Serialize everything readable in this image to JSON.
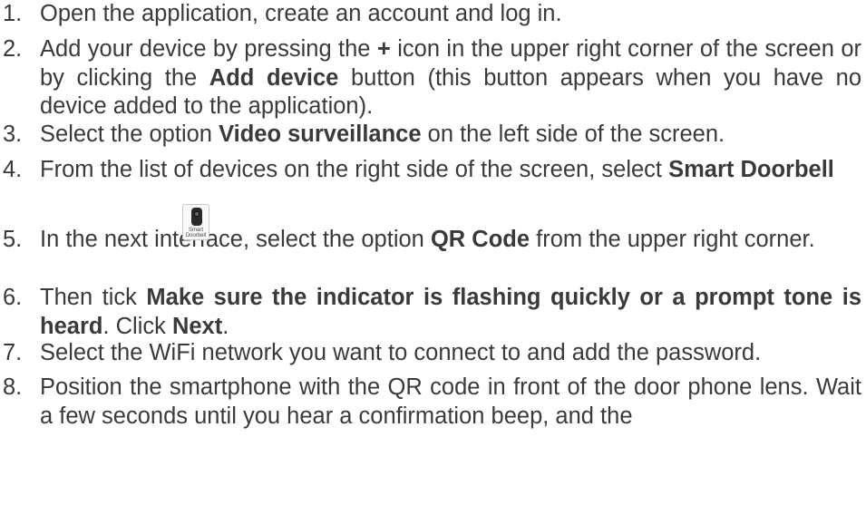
{
  "steps": [
    {
      "number": "1.",
      "parts": [
        "Open the application, create an account and log in."
      ]
    },
    {
      "number": "2.",
      "parts": [
        "Add your device by pressing the ",
        "+",
        " icon in the upper right corner of the screen or by clicking the ",
        "Add device",
        " button (this button appears when you have no device added to the application)."
      ]
    },
    {
      "number": "3.",
      "parts": [
        "Select the option ",
        "Video surveillance",
        " on the left side of the screen."
      ]
    },
    {
      "number": "4.",
      "parts": [
        "From the list of devices on the right side of the screen, select ",
        "Smart Doorbell"
      ],
      "icon": {
        "name": "smart-doorbell-icon",
        "caption_line1": "Smart",
        "caption_line2": "Doorbell"
      }
    },
    {
      "number": "5.",
      "parts": [
        "In the next interface, select the option ",
        "QR Code",
        " from the upper right corner."
      ]
    },
    {
      "number": "6.",
      "parts": [
        "Then tick ",
        "Make sure the indicator is flashing quickly or a prompt tone is heard",
        ". Click ",
        "Next",
        "."
      ]
    },
    {
      "number": "7.",
      "parts": [
        "Select the WiFi network you want to connect to and add the password."
      ]
    },
    {
      "number": "8.",
      "parts": [
        "Position the smartphone with the QR code in front of the door phone lens. Wait a few seconds until you hear a confirmation beep, and the"
      ]
    }
  ]
}
